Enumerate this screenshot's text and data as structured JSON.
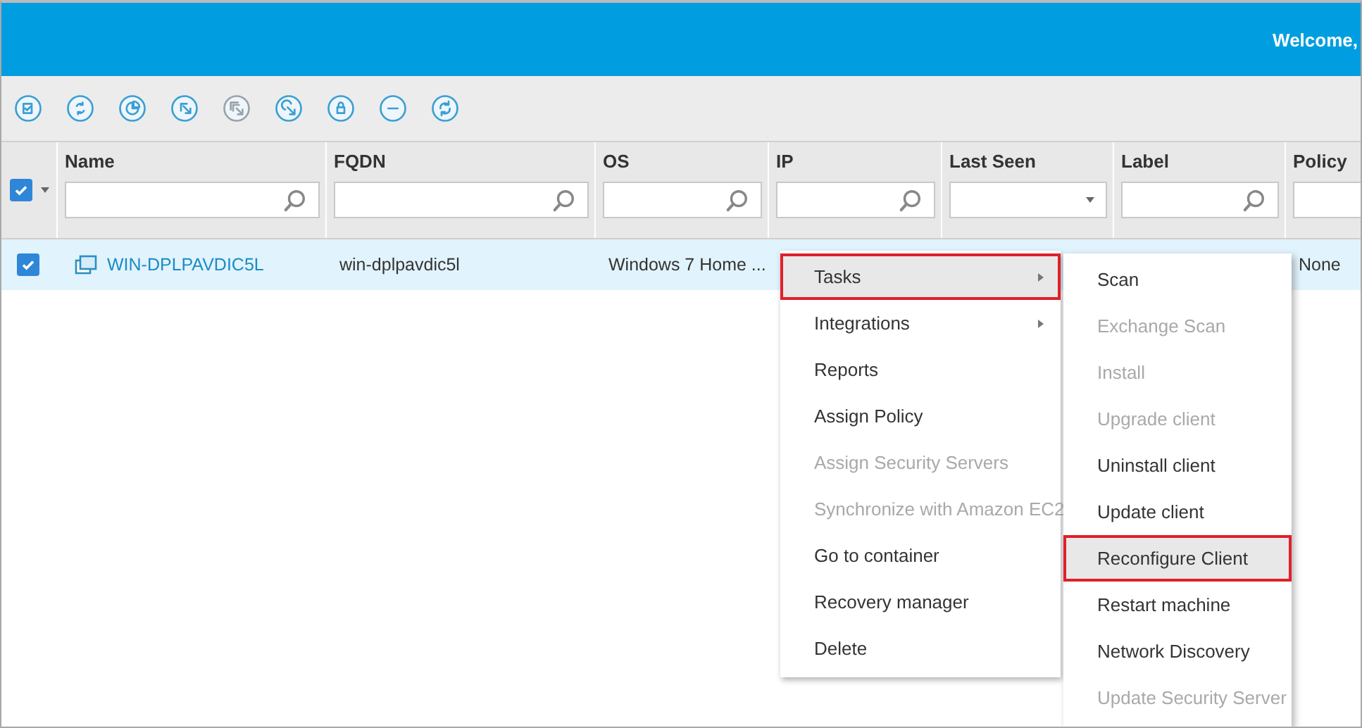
{
  "header": {
    "welcome": "Welcome,"
  },
  "toolbar": [
    {
      "kind": "check",
      "disabled": false
    },
    {
      "kind": "sync",
      "disabled": false
    },
    {
      "kind": "pie",
      "disabled": false
    },
    {
      "kind": "pointer",
      "disabled": false
    },
    {
      "kind": "pointer-stack",
      "disabled": true
    },
    {
      "kind": "pointer-ring",
      "disabled": false
    },
    {
      "kind": "lock",
      "disabled": false
    },
    {
      "kind": "minus",
      "disabled": false
    },
    {
      "kind": "refresh",
      "disabled": false
    }
  ],
  "table": {
    "select_all": {
      "checked": true
    },
    "columns": [
      {
        "label": "Name",
        "kind": "search"
      },
      {
        "label": "FQDN",
        "kind": "search"
      },
      {
        "label": "OS",
        "kind": "search"
      },
      {
        "label": "IP",
        "kind": "search"
      },
      {
        "label": "Last Seen",
        "kind": "dropdown"
      },
      {
        "label": "Label",
        "kind": "search"
      },
      {
        "label": "Policy",
        "kind": "text"
      }
    ],
    "rows": [
      {
        "checked": true,
        "name": "WIN-DPLPAVDIC5L",
        "fqdn": "win-dplpavdic5l",
        "os": "Windows 7 Home ...",
        "policy": "None"
      }
    ]
  },
  "context_menu": {
    "items": [
      {
        "label": "Tasks",
        "disabled": false,
        "submenu": true,
        "selected": true
      },
      {
        "label": "Integrations",
        "disabled": false,
        "submenu": true,
        "selected": false
      },
      {
        "label": "Reports",
        "disabled": false,
        "submenu": false,
        "selected": false
      },
      {
        "label": "Assign Policy",
        "disabled": false,
        "submenu": false,
        "selected": false
      },
      {
        "label": "Assign Security Servers",
        "disabled": true,
        "submenu": false,
        "selected": false
      },
      {
        "label": "Synchronize with Amazon EC2",
        "disabled": true,
        "submenu": false,
        "selected": false
      },
      {
        "label": "Go to container",
        "disabled": false,
        "submenu": false,
        "selected": false
      },
      {
        "label": "Recovery manager",
        "disabled": false,
        "submenu": false,
        "selected": false
      },
      {
        "label": "Delete",
        "disabled": false,
        "submenu": false,
        "selected": false
      }
    ]
  },
  "submenu": {
    "items": [
      {
        "label": "Scan",
        "disabled": false,
        "selected": false
      },
      {
        "label": "Exchange Scan",
        "disabled": true,
        "selected": false
      },
      {
        "label": "Install",
        "disabled": true,
        "selected": false
      },
      {
        "label": "Upgrade client",
        "disabled": true,
        "selected": false
      },
      {
        "label": "Uninstall client",
        "disabled": false,
        "selected": false
      },
      {
        "label": "Update client",
        "disabled": false,
        "selected": false
      },
      {
        "label": "Reconfigure Client",
        "disabled": false,
        "selected": true
      },
      {
        "label": "Restart machine",
        "disabled": false,
        "selected": false
      },
      {
        "label": "Network Discovery",
        "disabled": false,
        "selected": false
      },
      {
        "label": "Update Security Server",
        "disabled": true,
        "selected": false
      }
    ]
  }
}
